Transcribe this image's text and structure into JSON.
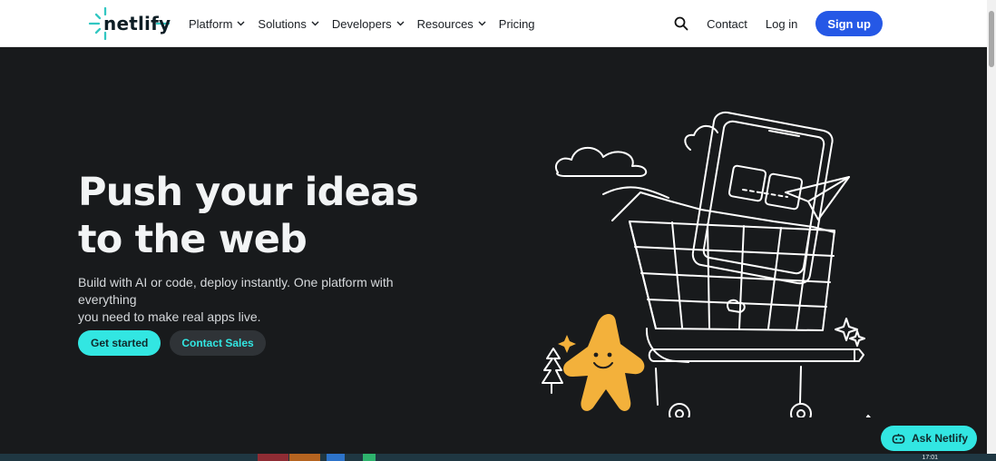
{
  "nav": {
    "logo_text": "netlify",
    "menu": [
      {
        "label": "Platform",
        "has_dropdown": true
      },
      {
        "label": "Solutions",
        "has_dropdown": true
      },
      {
        "label": "Developers",
        "has_dropdown": true
      },
      {
        "label": "Resources",
        "has_dropdown": true
      },
      {
        "label": "Pricing",
        "has_dropdown": false
      }
    ],
    "search_icon": "search-icon",
    "contact_label": "Contact",
    "login_label": "Log in",
    "signup_label": "Sign up"
  },
  "hero": {
    "title_line1": "Push your ideas",
    "title_line2": "to the web",
    "subtitle_line1": "Build with AI or code, deploy instantly. One platform with everything",
    "subtitle_line2": "you need to make real apps live.",
    "primary_cta": "Get started",
    "secondary_cta": "Contact Sales"
  },
  "chat": {
    "label": "Ask Netlify",
    "icon": "chatbot-icon"
  },
  "taskbar": {
    "time": "17:01"
  },
  "colors": {
    "brand_teal": "#32e6e2",
    "signup_blue": "#2558e6",
    "hero_bg": "#181a1c",
    "mascot_orange": "#f3b13b"
  }
}
